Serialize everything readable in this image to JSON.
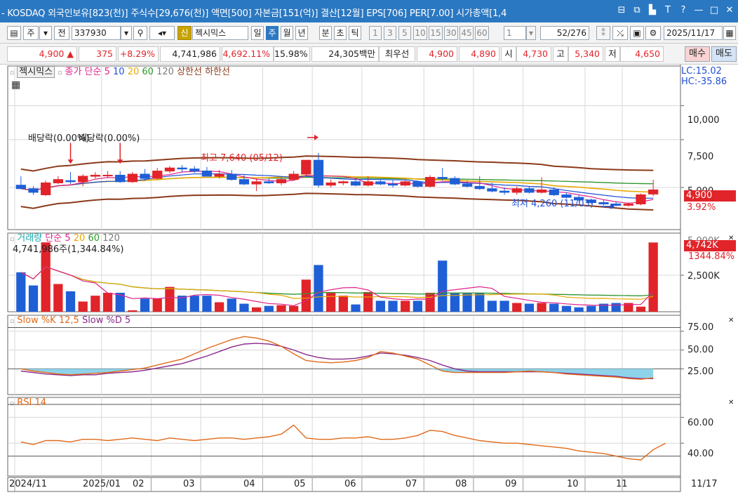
{
  "window": {
    "title": "- KOSDAQ 외국인보유[823(천)] 주식수[29,676(천)] 액면[500] 자본금[151(억)] 결산[12월] EPS[706] PER[7.00] 시가총액[1,4",
    "controls": [
      "⊟",
      "⧉",
      "▙",
      "T",
      "?",
      "—",
      "□",
      "✕"
    ]
  },
  "toolbar": {
    "period_mode": "주",
    "full_label": "전",
    "code": "337930",
    "badge": "신",
    "name": "젝시믹스",
    "periods": [
      "일",
      "주",
      "월",
      "년"
    ],
    "active_period": "주",
    "units": [
      "분",
      "초",
      "틱"
    ],
    "numbers": [
      "1",
      "3",
      "5",
      "10",
      "15",
      "30",
      "45",
      "60"
    ],
    "count_select": "1",
    "count_value": "52",
    "count_total": "/276",
    "date": "2025/11/17"
  },
  "pricebar": {
    "price": "4,900",
    "price_arrow": "▲",
    "change": "375",
    "change_pct": "+8.29%",
    "volume": "4,741,986",
    "volume_pct": "4,692.11%",
    "turnover": "15.98%",
    "amount": "24,305백만",
    "best_label": "최우선",
    "ask": "4,900",
    "bid": "4,890",
    "open_label": "시",
    "open": "4,730",
    "high_label": "고",
    "high": "5,340",
    "low_label": "저",
    "low": "4,650",
    "buy_button": "매수",
    "sell_button": "매도"
  },
  "price_panel": {
    "stock_label": "젝시믹스",
    "legend_prefix": "종가 단순",
    "legend_items": [
      {
        "label": "5",
        "color": "#e0248c"
      },
      {
        "label": "10",
        "color": "#1f4fd6"
      },
      {
        "label": "20",
        "color": "#e8a800"
      },
      {
        "label": "60",
        "color": "#2a9a2a"
      },
      {
        "label": "120",
        "color": "#7b7b7b"
      },
      {
        "label": "상한선",
        "color": "#8b3a1a"
      },
      {
        "label": "하한선",
        "color": "#8b3a1a"
      }
    ],
    "lc": "LC:15.02",
    "hc": "HC:-35.86",
    "dividend_1": "배당락(0.00%)",
    "dividend_2": "배당락(0.00%)",
    "high_annotation": "최고 7,640 (05/12)",
    "low_annotation": "최저 4,260 (11/03)",
    "current_price_tag": "4,900",
    "current_pct_tag": "3.92%",
    "y_ticks": [
      "10,000",
      "7,500",
      "5,000"
    ]
  },
  "volume_panel": {
    "title": "거래량",
    "legend_prefix": "단순",
    "legend_items": [
      {
        "label": "5",
        "color": "#e0248c"
      },
      {
        "label": "20",
        "color": "#e8a800"
      },
      {
        "label": "60",
        "color": "#2a9a2a"
      },
      {
        "label": "120",
        "color": "#7b7b7b"
      }
    ],
    "current": "4,741,986주(1,344.84%)",
    "tag_value": "4,742K",
    "tag_pct": "1344.84%",
    "y_ticks": [
      "5,000K",
      "2,500K"
    ]
  },
  "stoch_panel": {
    "title": "Slow %K 12,5",
    "title2": "Slow %D 5",
    "y_ticks": [
      "75.00",
      "50.00",
      "25.00"
    ]
  },
  "rsi_panel": {
    "title": "RSI 14",
    "y_ticks": [
      "60.00",
      "40.00"
    ]
  },
  "x_axis": [
    "2024/11",
    "2025/01",
    "02",
    "03",
    "04",
    "05",
    "06",
    "07",
    "08",
    "09",
    "10",
    "11",
    "11/17"
  ],
  "chart_data": {
    "type": "candlestick",
    "candles": [
      {
        "o": 5100,
        "h": 5500,
        "l": 4950,
        "c": 4950
      },
      {
        "o": 4950,
        "h": 5050,
        "l": 4700,
        "c": 4800
      },
      {
        "o": 4700,
        "h": 5300,
        "l": 4650,
        "c": 5200
      },
      {
        "o": 5200,
        "h": 5500,
        "l": 5150,
        "c": 5350
      },
      {
        "o": 5300,
        "h": 5700,
        "l": 5150,
        "c": 5250
      },
      {
        "o": 5250,
        "h": 5600,
        "l": 5050,
        "c": 5500
      },
      {
        "o": 5500,
        "h": 5700,
        "l": 5400,
        "c": 5550
      },
      {
        "o": 5550,
        "h": 5750,
        "l": 5450,
        "c": 5550
      },
      {
        "o": 5550,
        "h": 5750,
        "l": 5200,
        "c": 5250
      },
      {
        "o": 5250,
        "h": 5700,
        "l": 5200,
        "c": 5600
      },
      {
        "o": 5600,
        "h": 5850,
        "l": 5300,
        "c": 5400
      },
      {
        "o": 5400,
        "h": 5900,
        "l": 5350,
        "c": 5750
      },
      {
        "o": 5750,
        "h": 6000,
        "l": 5650,
        "c": 5900
      },
      {
        "o": 5900,
        "h": 6050,
        "l": 5700,
        "c": 5850
      },
      {
        "o": 5850,
        "h": 6000,
        "l": 5650,
        "c": 5750
      },
      {
        "o": 5750,
        "h": 5950,
        "l": 5500,
        "c": 5500
      },
      {
        "o": 5500,
        "h": 5800,
        "l": 5400,
        "c": 5600
      },
      {
        "o": 5600,
        "h": 5800,
        "l": 5300,
        "c": 5350
      },
      {
        "o": 5350,
        "h": 5550,
        "l": 5100,
        "c": 5150
      },
      {
        "o": 5150,
        "h": 5400,
        "l": 4850,
        "c": 5250
      },
      {
        "o": 5250,
        "h": 5400,
        "l": 5150,
        "c": 5200
      },
      {
        "o": 5200,
        "h": 5450,
        "l": 5100,
        "c": 5350
      },
      {
        "o": 5350,
        "h": 5750,
        "l": 5300,
        "c": 5600
      },
      {
        "o": 5600,
        "h": 6300,
        "l": 5550,
        "c": 6300
      },
      {
        "o": 6300,
        "h": 6700,
        "l": 5000,
        "c": 5100
      },
      {
        "o": 5100,
        "h": 5350,
        "l": 5000,
        "c": 5200
      },
      {
        "o": 5200,
        "h": 5300,
        "l": 5100,
        "c": 5250
      },
      {
        "o": 5250,
        "h": 5350,
        "l": 5050,
        "c": 5100
      },
      {
        "o": 5100,
        "h": 5500,
        "l": 5050,
        "c": 5250
      },
      {
        "o": 5250,
        "h": 5350,
        "l": 5100,
        "c": 5150
      },
      {
        "o": 5150,
        "h": 5350,
        "l": 5000,
        "c": 5100
      },
      {
        "o": 5100,
        "h": 5350,
        "l": 5050,
        "c": 5250
      },
      {
        "o": 5250,
        "h": 5300,
        "l": 5000,
        "c": 5050
      },
      {
        "o": 5050,
        "h": 5550,
        "l": 5000,
        "c": 5450
      },
      {
        "o": 5450,
        "h": 5900,
        "l": 5300,
        "c": 5400
      },
      {
        "o": 5400,
        "h": 5500,
        "l": 5100,
        "c": 5150
      },
      {
        "o": 5150,
        "h": 5300,
        "l": 5000,
        "c": 5050
      },
      {
        "o": 5050,
        "h": 5500,
        "l": 4900,
        "c": 4950
      },
      {
        "o": 4950,
        "h": 5200,
        "l": 4800,
        "c": 4850
      },
      {
        "o": 4850,
        "h": 5000,
        "l": 4700,
        "c": 4800
      },
      {
        "o": 4800,
        "h": 5050,
        "l": 4700,
        "c": 4950
      },
      {
        "o": 4950,
        "h": 5050,
        "l": 4750,
        "c": 4800
      },
      {
        "o": 4800,
        "h": 5450,
        "l": 4750,
        "c": 4900
      },
      {
        "o": 4900,
        "h": 5000,
        "l": 4650,
        "c": 4700
      },
      {
        "o": 4700,
        "h": 4800,
        "l": 4550,
        "c": 4600
      },
      {
        "o": 4600,
        "h": 4700,
        "l": 4450,
        "c": 4500
      },
      {
        "o": 4500,
        "h": 4550,
        "l": 4350,
        "c": 4400
      },
      {
        "o": 4400,
        "h": 4500,
        "l": 4300,
        "c": 4350
      },
      {
        "o": 4350,
        "h": 4450,
        "l": 4260,
        "c": 4300
      },
      {
        "o": 4300,
        "h": 4400,
        "l": 4250,
        "c": 4350
      },
      {
        "o": 4350,
        "h": 4750,
        "l": 4300,
        "c": 4700
      },
      {
        "o": 4730,
        "h": 5340,
        "l": 4650,
        "c": 4900
      }
    ],
    "volume_k": [
      2700,
      1800,
      4750,
      1900,
      1400,
      700,
      1100,
      1300,
      1300,
      100,
      900,
      900,
      1700,
      1100,
      1100,
      1100,
      650,
      900,
      550,
      300,
      400,
      450,
      400,
      2200,
      3200,
      1300,
      1100,
      500,
      1350,
      750,
      750,
      750,
      750,
      1300,
      3500,
      1250,
      1250,
      1250,
      750,
      750,
      600,
      550,
      600,
      550,
      400,
      300,
      400,
      550,
      600,
      600,
      350,
      4742
    ],
    "stoch_k": [
      25,
      22,
      20,
      18,
      17,
      18,
      19,
      20,
      22,
      24,
      26,
      30,
      34,
      38,
      45,
      52,
      58,
      64,
      68,
      66,
      62,
      55,
      45,
      36,
      34,
      33,
      34,
      36,
      40,
      48,
      46,
      42,
      38,
      30,
      22,
      20,
      20,
      20,
      20,
      20,
      21,
      22,
      21,
      20,
      18,
      17,
      16,
      15,
      14,
      12,
      11,
      13,
      14,
      16,
      22
    ],
    "stoch_d": [
      22,
      20,
      18,
      17,
      16,
      17,
      17,
      19,
      20,
      21,
      23,
      26,
      29,
      32,
      37,
      42,
      48,
      54,
      58,
      59,
      58,
      55,
      50,
      44,
      40,
      38,
      38,
      39,
      42,
      46,
      45,
      43,
      40,
      36,
      30,
      25,
      22,
      21,
      21,
      21,
      21,
      21,
      21,
      20,
      19,
      18,
      17,
      16,
      15,
      13,
      12,
      12,
      13,
      14,
      16
    ],
    "rsi": [
      41,
      39,
      42,
      42,
      41,
      43,
      43,
      42,
      43,
      44,
      43,
      42,
      44,
      43,
      42,
      43,
      44,
      44,
      43,
      44,
      45,
      47,
      54,
      44,
      43,
      43,
      44,
      44,
      45,
      43,
      43,
      44,
      46,
      50,
      49,
      46,
      44,
      42,
      41,
      40,
      40,
      39,
      38,
      37,
      36,
      34,
      33,
      32,
      30,
      28,
      27,
      35,
      40
    ],
    "price_range": [
      3500,
      14000
    ],
    "volume_range": [
      0,
      5000
    ],
    "stoch_range": [
      0,
      100
    ],
    "rsi_range": [
      0,
      100
    ]
  }
}
